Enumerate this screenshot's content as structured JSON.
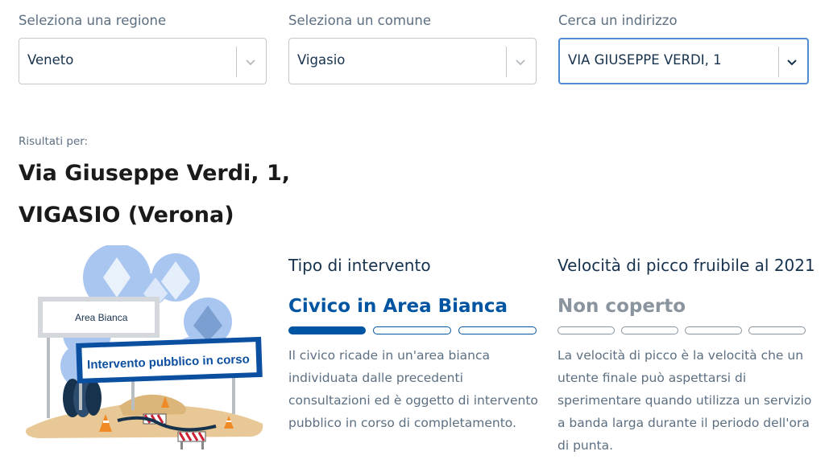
{
  "filters": {
    "region": {
      "label": "Seleziona una regione",
      "value": "Veneto"
    },
    "comune": {
      "label": "Seleziona un comune",
      "value": "Vigasio"
    },
    "address": {
      "label": "Cerca un indirizzo",
      "value": "VIA GIUSEPPE VERDI, 1"
    }
  },
  "results": {
    "label": "Risultati per:",
    "title_line1": "Via Giuseppe Verdi, 1,",
    "title_line2": "VIGASIO (Verona)"
  },
  "illustration": {
    "sign_small": "Area Bianca",
    "sign_large": "Intervento pubblico in corso"
  },
  "intervento": {
    "heading": "Tipo di intervento",
    "value": "Civico in Area Bianca",
    "value_color": "#0055a3",
    "segments_total": 3,
    "segments_filled": 1,
    "description": "Il civico ricade in un'area bianca individuata dalle precedenti consultazioni ed è oggetto di intervento pubblico in corso di completamento."
  },
  "velocita": {
    "heading": "Velocità di picco fruibile al 2021",
    "value": "Non coperto",
    "value_color": "#8a949e",
    "segments_total": 4,
    "segments_filled": 0,
    "description": "La velocità di picco è la velocità che un utente finale può aspettarsi di sperimentare quando utilizza un servizio a banda larga durante il periodo dell'ora di punta."
  },
  "colors": {
    "accent": "#0055a3",
    "focus_border": "#4f8bd3",
    "text_muted": "#5c6f82"
  }
}
